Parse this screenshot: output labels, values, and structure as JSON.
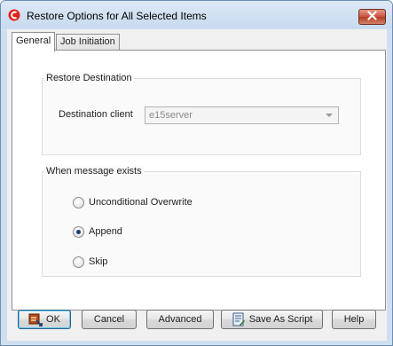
{
  "window": {
    "title": "Restore Options for All Selected Items",
    "app_icon": "commvault-logo-icon",
    "close_icon": "close-icon"
  },
  "tabs": [
    {
      "label": "General",
      "active": true
    },
    {
      "label": "Job Initiation",
      "active": false
    }
  ],
  "restore_destination": {
    "group_title": "Restore Destination",
    "destination_client_label": "Destination client",
    "destination_client_value": "e15server",
    "dropdown_icon": "chevron-down-icon"
  },
  "message_exists": {
    "group_title": "When message exists",
    "options": [
      {
        "label": "Unconditional Overwrite",
        "checked": false
      },
      {
        "label": "Append",
        "checked": true
      },
      {
        "label": "Skip",
        "checked": false
      }
    ]
  },
  "buttons": {
    "ok": "OK",
    "cancel": "Cancel",
    "advanced": "Advanced",
    "save_as_script": "Save As Script",
    "help": "Help",
    "ok_icon": "restore-icon",
    "script_icon": "script-icon"
  },
  "colors": {
    "window_frame": "#cfdff0",
    "close_button": "#c8523b",
    "selected_radio": "#1b3f6e"
  }
}
